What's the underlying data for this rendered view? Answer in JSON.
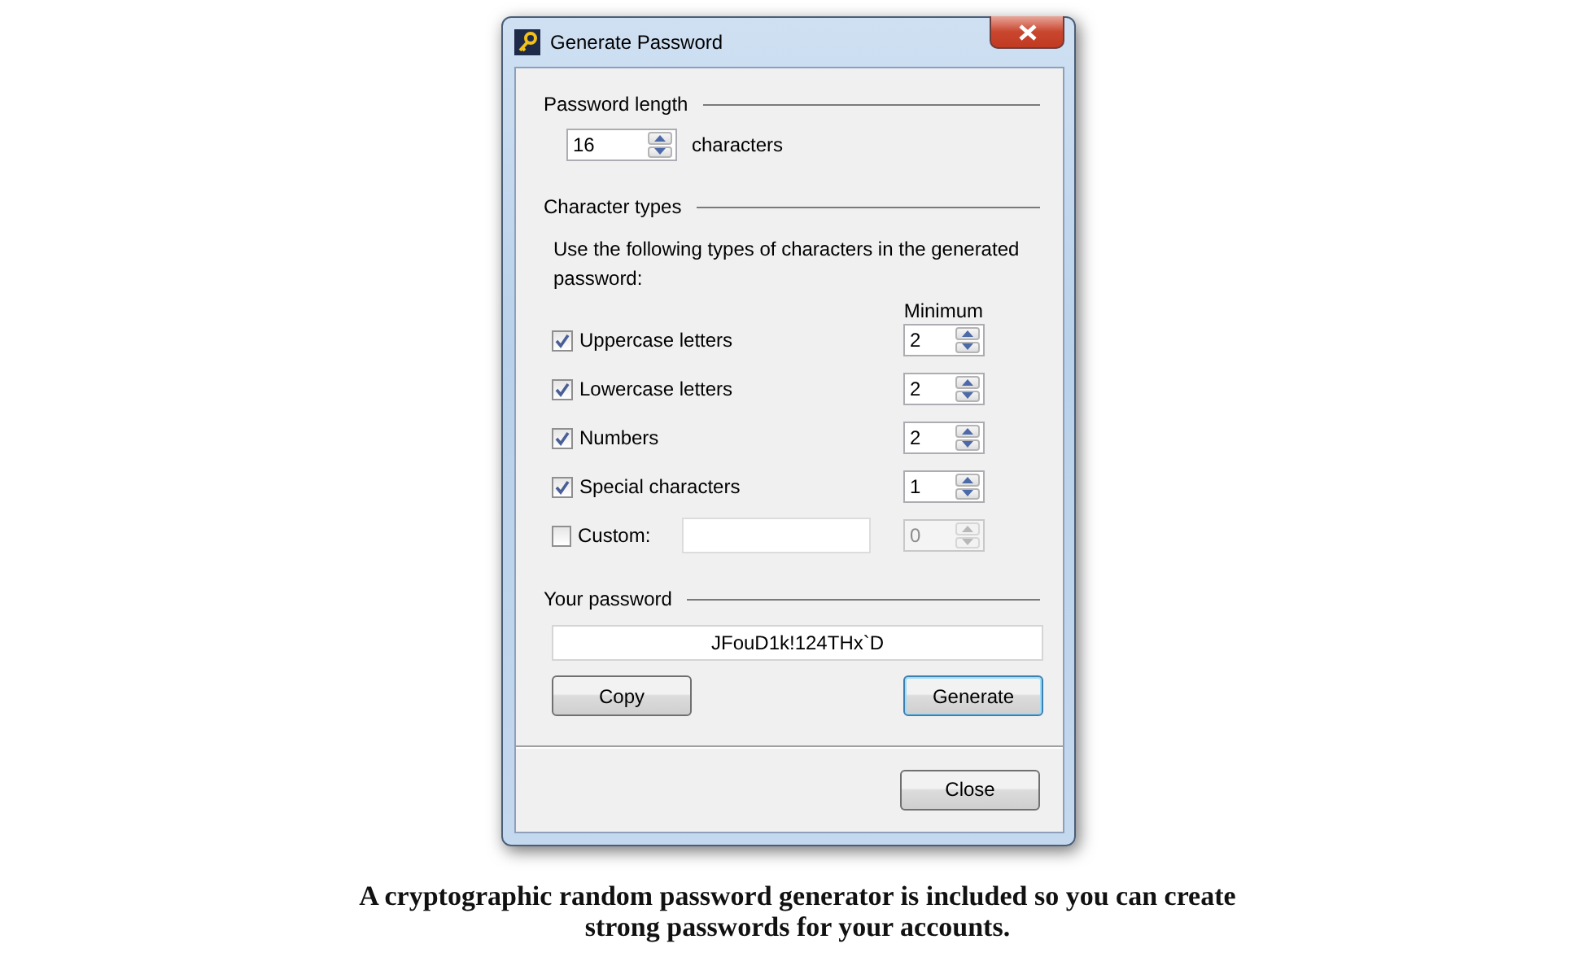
{
  "window": {
    "title": "Generate Password"
  },
  "length_section": {
    "heading": "Password length",
    "value": "16",
    "unit": "characters"
  },
  "types_section": {
    "heading": "Character types",
    "description": "Use the following types of characters in the generated password:",
    "minimum_heading": "Minimum",
    "types": [
      {
        "kind": "fixed",
        "label": "Uppercase letters",
        "checked": true,
        "minimum": "2",
        "disabled": false
      },
      {
        "kind": "fixed",
        "label": "Lowercase letters",
        "checked": true,
        "minimum": "2",
        "disabled": false
      },
      {
        "kind": "fixed",
        "label": "Numbers",
        "checked": true,
        "minimum": "2",
        "disabled": false
      },
      {
        "kind": "fixed",
        "label": "Special characters",
        "checked": true,
        "minimum": "1",
        "disabled": false
      },
      {
        "kind": "custom",
        "label": "Custom:",
        "checked": false,
        "minimum": "0",
        "disabled": true
      }
    ]
  },
  "password_section": {
    "heading": "Your password",
    "value": "JFouD1k!124THx`D"
  },
  "buttons": [
    {
      "label": "Copy",
      "default": false
    },
    {
      "label": "Generate",
      "default": true
    }
  ],
  "close_button": {
    "label": "Close"
  },
  "caption": "A cryptographic random password generator is included so you can create strong passwords for your accounts."
}
